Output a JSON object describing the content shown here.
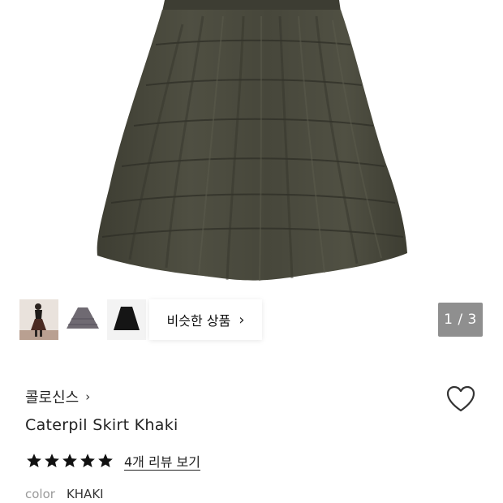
{
  "gallery": {
    "similar_label": "비슷한 상품",
    "page_counter": "1 / 3",
    "thumbnails": [
      "thumbnail-1",
      "thumbnail-2",
      "thumbnail-3"
    ]
  },
  "product": {
    "brand": "콜로신스",
    "name": "Caterpil Skirt Khaki",
    "rating_stars": 5,
    "review_link": "4개 리뷰 보기",
    "color_label": "color",
    "color_value": "KHAKI"
  },
  "colors": {
    "skirt": "#4a4a3d",
    "skirt_dark": "#3b3b30",
    "counter_bg": "#8f8f8f"
  }
}
